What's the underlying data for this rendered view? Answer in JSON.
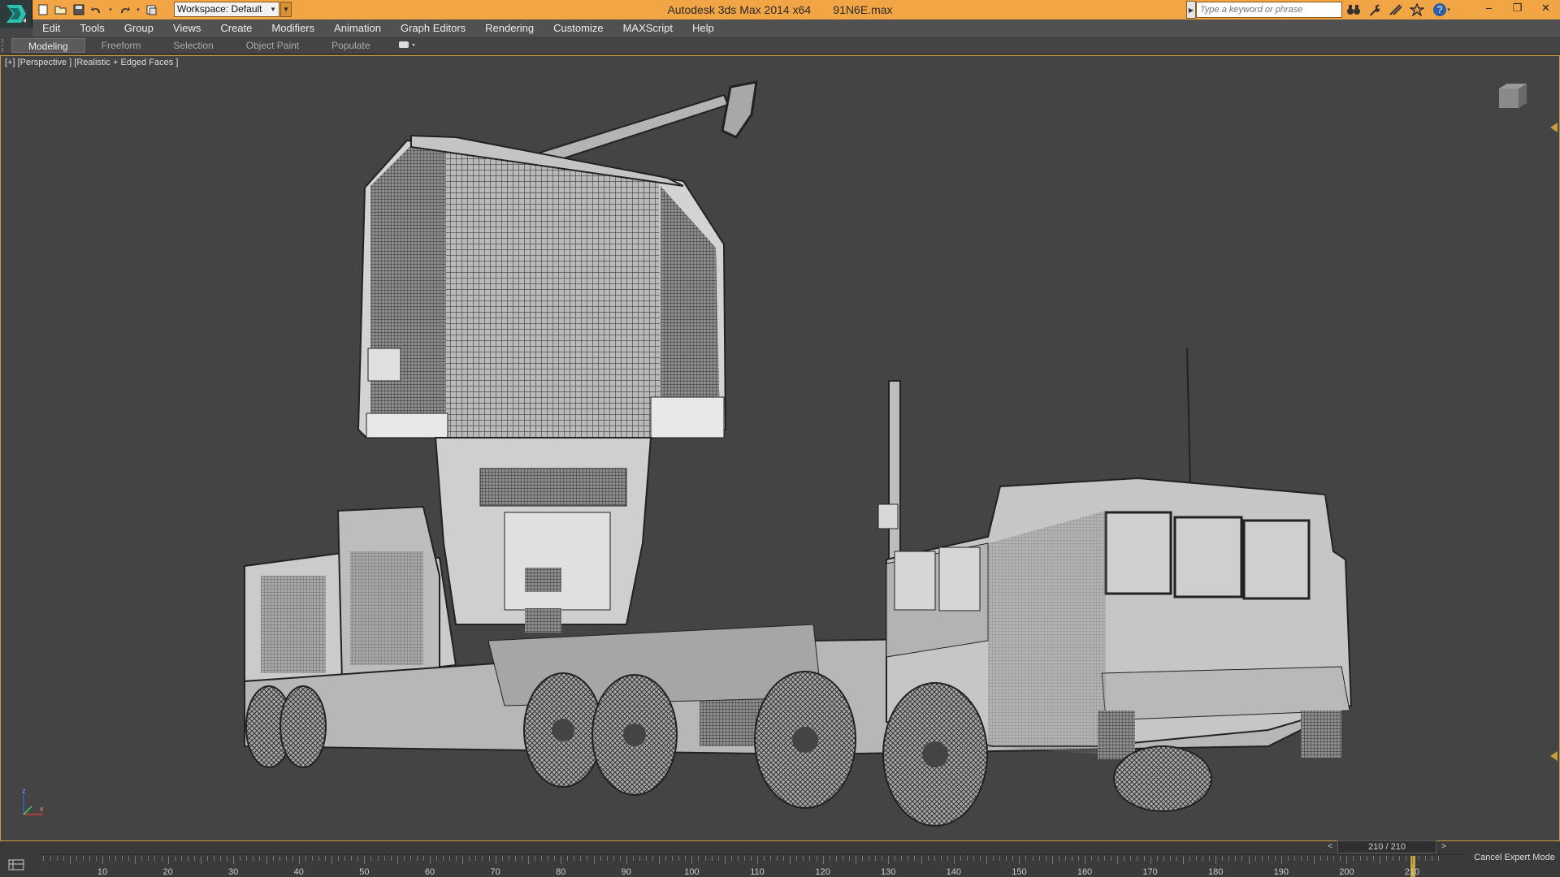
{
  "window": {
    "app_title": "Autodesk 3ds Max  2014 x64",
    "file_name": "91N6E.max",
    "workspace_label": "Workspace: Default",
    "search_placeholder": "Type a keyword or phrase"
  },
  "menu": [
    "Edit",
    "Tools",
    "Group",
    "Views",
    "Create",
    "Modifiers",
    "Animation",
    "Graph Editors",
    "Rendering",
    "Customize",
    "MAXScript",
    "Help"
  ],
  "ribbon_tabs": [
    {
      "label": "Modeling",
      "active": true
    },
    {
      "label": "Freeform",
      "active": false
    },
    {
      "label": "Selection",
      "active": false
    },
    {
      "label": "Object Paint",
      "active": false
    },
    {
      "label": "Populate",
      "active": false
    }
  ],
  "viewport": {
    "label": "[+] [Perspective ] [Realistic + Edged Faces ]",
    "axis_labels": {
      "z": "z",
      "x": "x"
    }
  },
  "timeline": {
    "current": "210 / 210",
    "prev_label": "<",
    "next_label": ">",
    "tick_labels": [
      "10",
      "20",
      "30",
      "40",
      "50",
      "60",
      "70",
      "80",
      "90",
      "100",
      "110",
      "120",
      "130",
      "140",
      "150",
      "160",
      "170",
      "180",
      "190",
      "200",
      "210"
    ],
    "expert_mode_label": "Cancel Expert Mode"
  },
  "colors": {
    "titlebar": "#f1a544",
    "viewport_bg": "#444444",
    "menubar": "#515151",
    "accent_border": "#c89d3e"
  },
  "icons": [
    "app-logo-icon",
    "new-file-icon",
    "open-file-icon",
    "save-icon",
    "undo-icon",
    "redo-icon",
    "project-folder-icon",
    "binoculars-icon",
    "wrench-icon",
    "subscription-icon",
    "star-icon",
    "help-icon",
    "minimize-icon",
    "restore-icon",
    "close-icon",
    "viewcube-icon",
    "trackbar-icon"
  ]
}
